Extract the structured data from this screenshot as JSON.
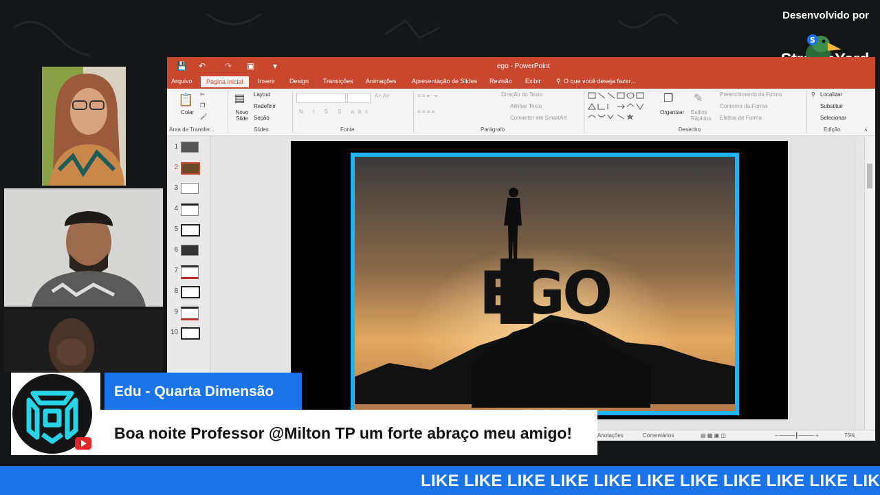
{
  "branding": {
    "developed_by": "Desenvolvido por",
    "logo_text": "StreamYard"
  },
  "ppt": {
    "window_title": "ego - PowerPoint",
    "tabs": [
      "Arquivo",
      "Página Inicial",
      "Inserir",
      "Design",
      "Transições",
      "Animações",
      "Apresentação de Slides",
      "Revisão",
      "Exibir"
    ],
    "tell_me": "O que você deseja fazer...",
    "ribbon": {
      "paste": "Colar",
      "new_slide": "Novo Slide",
      "layout": "Layout",
      "reset": "Redefinir",
      "section": "Seção",
      "text_direction": "Direção do Texto",
      "align_text": "Alinhar Texto",
      "smartart": "Converter em SmartArt",
      "arrange": "Organizar",
      "quick_styles": "Estilos Rápidos",
      "shape_fill": "Preenchimento da Forma",
      "shape_outline": "Contorno da Forma",
      "shape_effects": "Efeitos de Forma",
      "find": "Localizar",
      "replace": "Substituir",
      "select": "Selecionar",
      "groups": [
        "Área de Transfer...",
        "Slides",
        "Fonte",
        "Parágrafo",
        "Desenho",
        "Edição"
      ]
    },
    "slides": [
      "1",
      "2",
      "3",
      "4",
      "5",
      "6",
      "7",
      "8",
      "9",
      "10"
    ],
    "selected_slide": "2",
    "slide_text": "EGO",
    "status": {
      "notes": "Anotações",
      "comments": "Comentários",
      "zoom": "75%"
    }
  },
  "comment": {
    "author": "Edu - Quarta Dimensão",
    "message": "Boa noite Professor @Milton TP um forte abraço meu amigo!"
  },
  "ticker": {
    "text": "LIKE LIKE LIKE LIKE LIKE LIKE LIKE LIKE LIKE LIKE LIKE"
  },
  "colors": {
    "ppt_accent": "#c9472d",
    "streamyard_blue": "#1a73e8",
    "slide_frame": "#1fb3ef"
  }
}
